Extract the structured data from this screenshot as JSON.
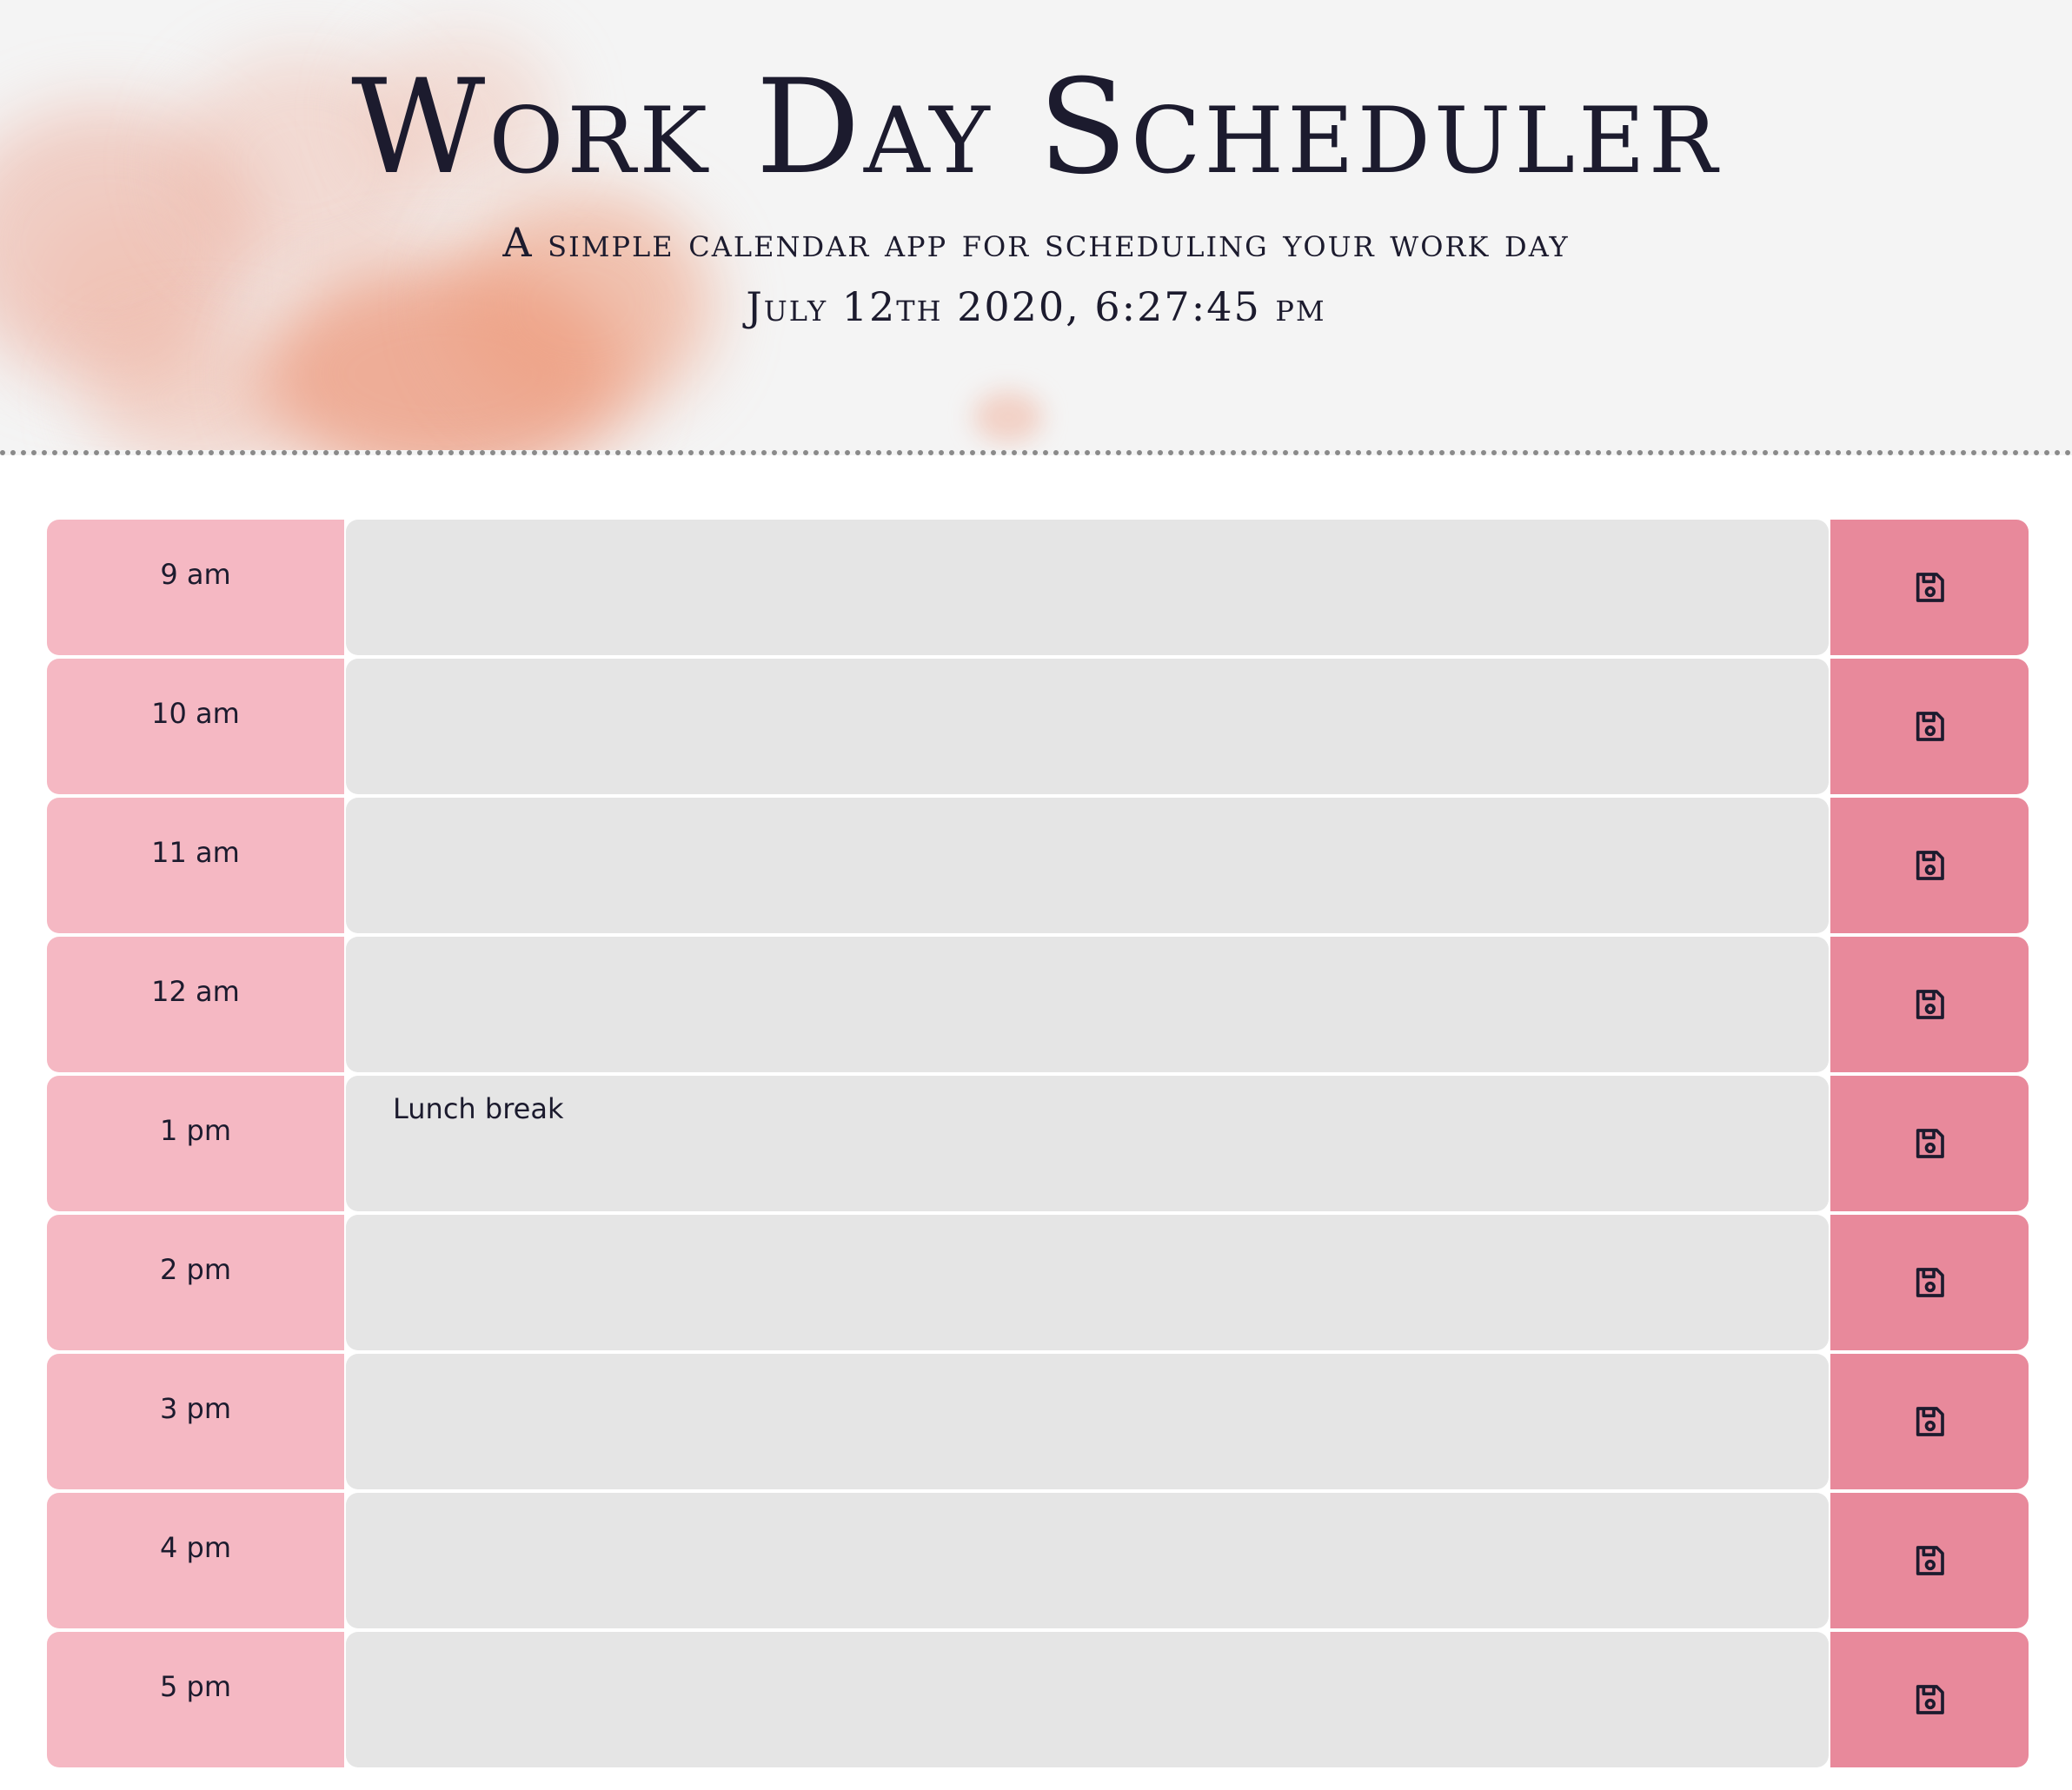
{
  "header": {
    "title": "Work Day Scheduler",
    "subtitle": "A simple calendar app for scheduling your work day",
    "current_day": "July 12th 2020, 6:27:45 pm"
  },
  "colors": {
    "hour_bg": "#f5b8c3",
    "description_bg": "#e5e5e5",
    "save_bg": "#e8899b",
    "jumbotron_bg": "#f4f4f4"
  },
  "timeblocks": [
    {
      "hour": "9 am",
      "text": "",
      "save_icon": "floppy-disk-icon"
    },
    {
      "hour": "10 am",
      "text": "",
      "save_icon": "floppy-disk-icon"
    },
    {
      "hour": "11 am",
      "text": "",
      "save_icon": "floppy-disk-icon"
    },
    {
      "hour": "12 am",
      "text": "",
      "save_icon": "floppy-disk-icon"
    },
    {
      "hour": "1 pm",
      "text": "Lunch break",
      "save_icon": "floppy-disk-icon"
    },
    {
      "hour": "2 pm",
      "text": "",
      "save_icon": "floppy-disk-icon"
    },
    {
      "hour": "3 pm",
      "text": "",
      "save_icon": "floppy-disk-icon"
    },
    {
      "hour": "4 pm",
      "text": "",
      "save_icon": "floppy-disk-icon"
    },
    {
      "hour": "5 pm",
      "text": "",
      "save_icon": "floppy-disk-icon"
    }
  ]
}
